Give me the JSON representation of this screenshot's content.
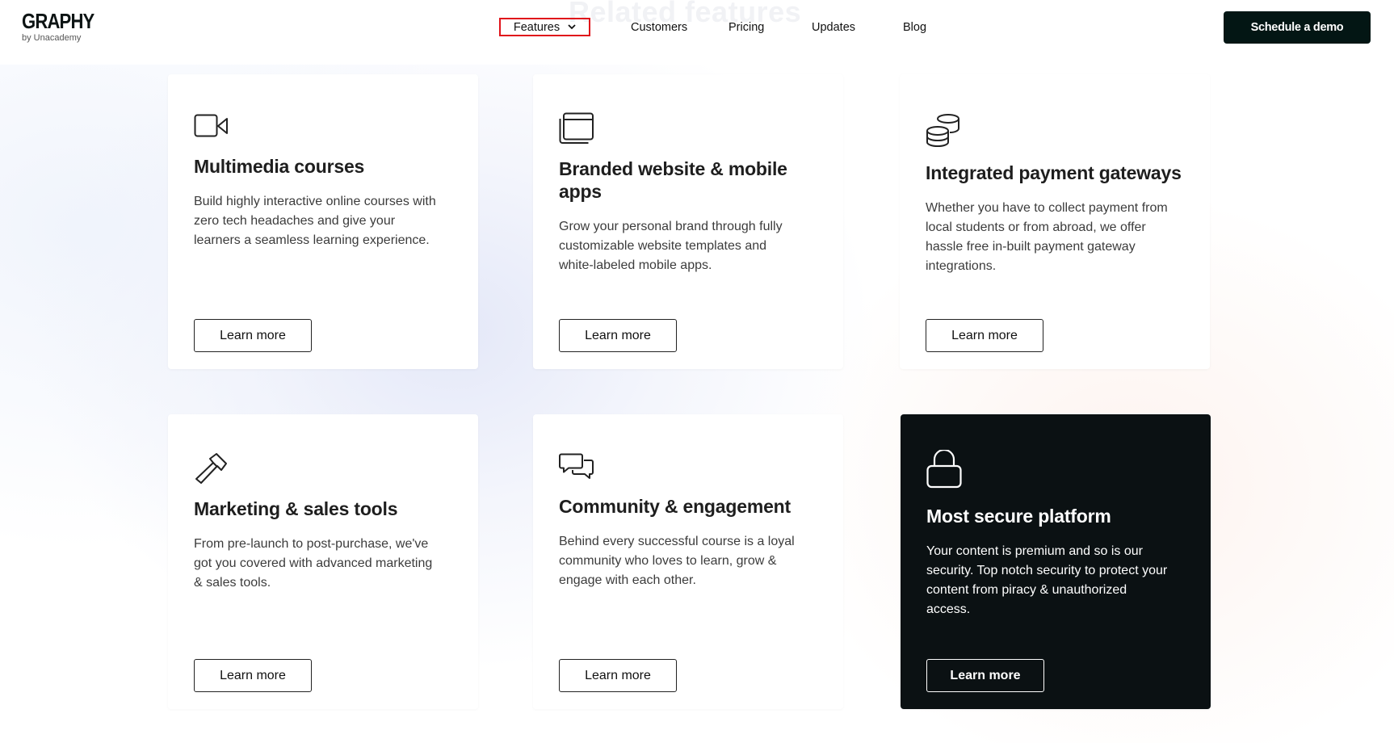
{
  "header": {
    "logo": {
      "name": "GRAPHY",
      "tagline": "by Unacademy"
    },
    "nav": [
      {
        "label": "Features",
        "has_dropdown": true,
        "highlighted": true
      },
      {
        "label": "Customers"
      },
      {
        "label": "Pricing"
      },
      {
        "label": "Updates"
      },
      {
        "label": "Blog"
      }
    ],
    "cta_label": "Schedule a demo"
  },
  "section_heading": "Related features",
  "cards": [
    {
      "icon": "video-camera-icon",
      "title": "Multimedia courses",
      "description": "Build highly interactive online courses with zero tech headaches and give your learners a seamless learning experience.",
      "button": "Learn more"
    },
    {
      "icon": "browser-window-icon",
      "title": "Branded website & mobile apps",
      "description": "Grow your personal brand through fully customizable website templates and white-labeled mobile apps.",
      "button": "Learn more"
    },
    {
      "icon": "coins-stack-icon",
      "title": "Integrated payment gateways",
      "description": "Whether you have to collect payment from local students or from abroad, we offer hassle free in-built payment gateway integrations.",
      "button": "Learn more"
    },
    {
      "icon": "hammer-icon",
      "title": "Marketing & sales tools",
      "description": "From pre-launch to post-purchase, we've got you covered with advanced marketing & sales tools.",
      "button": "Learn more"
    },
    {
      "icon": "chat-bubbles-icon",
      "title": "Community & engagement",
      "description": "Behind every successful course is a loyal community who loves to learn, grow & engage with each other.",
      "button": "Learn more"
    },
    {
      "icon": "lock-icon",
      "title": "Most secure platform",
      "description": "Your content is premium and so is our security. Top notch security to protect your content from piracy & unauthorized access.",
      "button": "Learn more",
      "dark": true
    }
  ],
  "colors": {
    "dark": "#0b1113",
    "cta": "#031614",
    "highlight_border": "#e0141b"
  }
}
